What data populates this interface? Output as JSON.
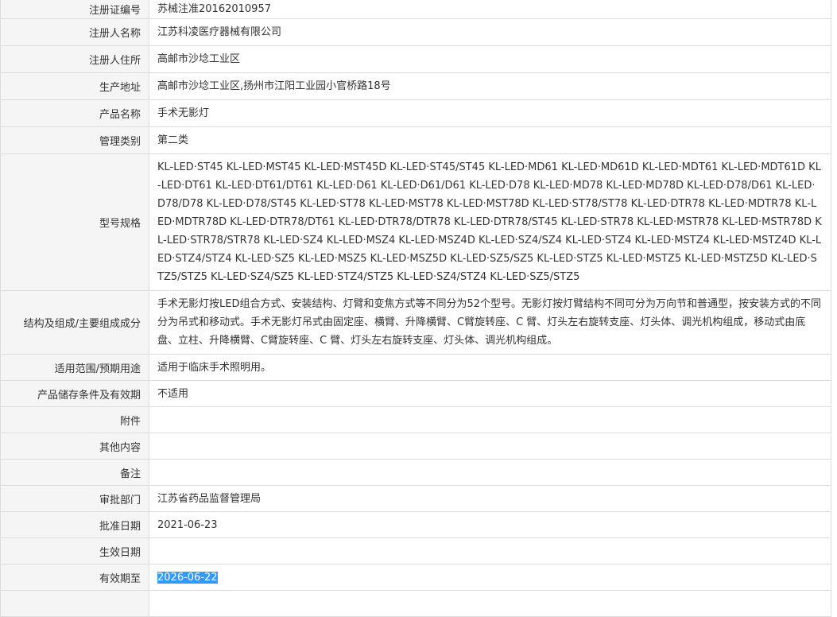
{
  "rows": [
    {
      "key": "注册证编号",
      "value": "苏械注准20162010957"
    },
    {
      "key": "注册人名称",
      "value": "江苏科凌医疗器械有限公司"
    },
    {
      "key": "注册人住所",
      "value": "高邮市沙埝工业区"
    },
    {
      "key": "生产地址",
      "value": "高邮市沙埝工业区,扬州市江阳工业园小官桥路18号"
    },
    {
      "key": "产品名称",
      "value": "手术无影灯"
    },
    {
      "key": "管理类别",
      "value": "第二类"
    },
    {
      "key": "型号规格",
      "value": "KL-LED·ST45 KL-LED·MST45 KL-LED·MST45D KL-LED·ST45/ST45 KL-LED·MD61 KL-LED·MD61D KL-LED·MDT61 KL-LED·MDT61D KL-LED·DT61 KL-LED·DT61/DT61 KL-LED·D61 KL-LED·D61/D61 KL-LED·D78 KL-LED·MD78 KL-LED·MD78D KL-LED·D78/D61 KL-LED·D78/D78 KL-LED·D78/ST45 KL-LED·ST78 KL-LED·MST78 KL-LED·MST78D KL-LED·ST78/ST78 KL-LED·DTR78 KL-LED·MDTR78 KL-LED·MDTR78D KL-LED·DTR78/DT61 KL-LED·DTR78/DTR78 KL-LED·DTR78/ST45 KL-LED·STR78 KL-LED·MSTR78 KL-LED·MSTR78D KL-LED·STR78/STR78 KL-LED·SZ4 KL-LED·MSZ4 KL-LED·MSZ4D KL-LED·SZ4/SZ4 KL-LED·STZ4 KL-LED·MSTZ4 KL-LED·MSTZ4D KL-LED·STZ4/STZ4 KL-LED·SZ5 KL-LED·MSZ5 KL-LED·MSZ5D KL-LED·SZ5/SZ5 KL-LED·STZ5 KL-LED·MSTZ5 KL-LED·MSTZ5D KL-LED·STZ5/STZ5 KL-LED·SZ4/SZ5 KL-LED·STZ4/STZ5 KL-LED·SZ4/STZ4 KL-LED·SZ5/STZ5"
    },
    {
      "key": "结构及组成/主要组成成分",
      "value": "手术无影灯按LED组合方式、安装结构、灯臂和变焦方式等不同分为52个型号。无影灯按灯臂结构不同可分为万向节和普通型，按安装方式的不同分为吊式和移动式。手术无影灯吊式由固定座、横臂、升降横臂、C臂旋转座、C 臂、灯头左右旋转支座、灯头体、调光机构组成，移动式由底盘、立柱、升降横臂、C臂旋转座、C 臂、灯头左右旋转支座、灯头体、调光机构组成。"
    },
    {
      "key": "适用范围/预期用途",
      "value": "适用于临床手术照明用。"
    },
    {
      "key": "产品储存条件及有效期",
      "value": "不适用"
    },
    {
      "key": "附件",
      "value": ""
    },
    {
      "key": "其他内容",
      "value": ""
    },
    {
      "key": "备注",
      "value": ""
    },
    {
      "key": "审批部门",
      "value": "江苏省药品监督管理局"
    },
    {
      "key": "批准日期",
      "value": "2021-06-23"
    },
    {
      "key": "生效日期",
      "value": ""
    },
    {
      "key": "有效期至",
      "value": "2026-06-22"
    },
    {
      "key": "",
      "value": ""
    }
  ]
}
